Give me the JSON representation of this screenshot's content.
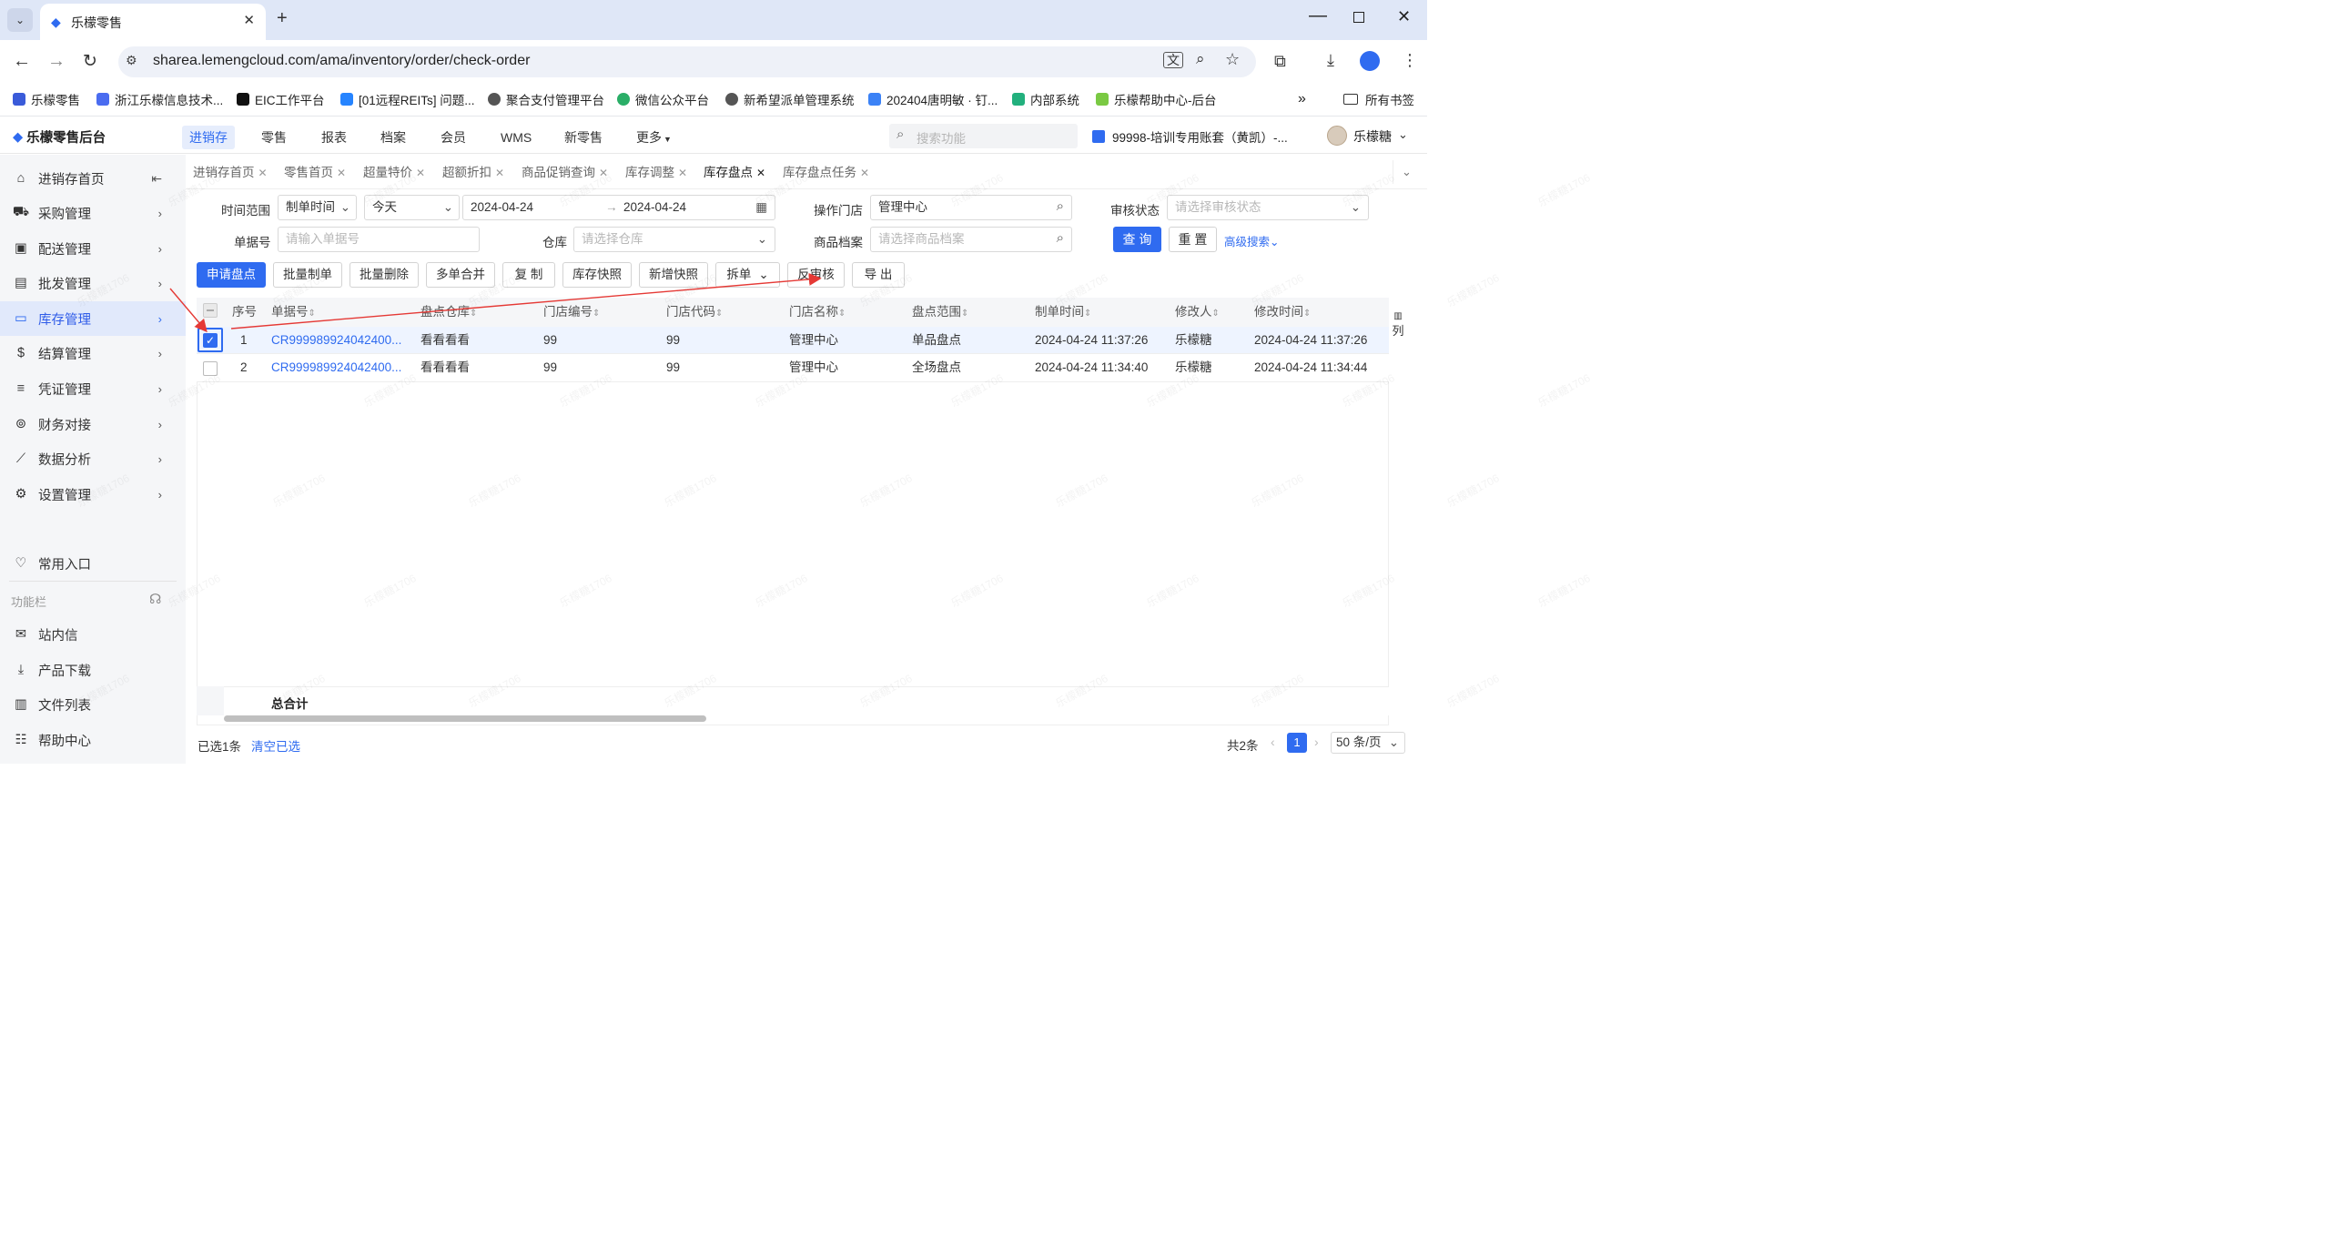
{
  "browser": {
    "tab_title": "乐檬零售",
    "url": "sharea.lemengcloud.com/ama/inventory/order/check-order",
    "bookmarks": [
      "乐檬零售",
      "浙江乐檬信息技术...",
      "EIC工作平台",
      "[01远程REITs] 问题...",
      "聚合支付管理平台",
      "微信公众平台",
      "新希望派单管理系统",
      "202404唐明敏 · 钉...",
      "内部系统",
      "乐檬帮助中心-后台"
    ],
    "all_bookmarks": "所有书签"
  },
  "app": {
    "logo": "乐檬零售后台",
    "nav": [
      "进销存",
      "零售",
      "报表",
      "档案",
      "会员",
      "WMS",
      "新零售",
      "更多"
    ],
    "search_placeholder": "搜索功能",
    "account": "99998-培训专用账套（黄凯）-...",
    "user": "乐檬糖"
  },
  "sidebar": {
    "items": [
      "进销存首页",
      "采购管理",
      "配送管理",
      "批发管理",
      "库存管理",
      "结算管理",
      "凭证管理",
      "财务对接",
      "数据分析",
      "设置管理"
    ],
    "common": "常用入口",
    "toolbar_label": "功能栏",
    "bottom": [
      "站内信",
      "产品下载",
      "文件列表",
      "帮助中心"
    ]
  },
  "page_tabs": [
    "进销存首页",
    "零售首页",
    "超量特价",
    "超额折扣",
    "商品促销查询",
    "库存调整",
    "库存盘点",
    "库存盘点任务"
  ],
  "form": {
    "time_range_label": "时间范围",
    "time_type": "制单时间",
    "time_preset": "今天",
    "date_from": "2024-04-24",
    "date_to": "2024-04-24",
    "store_label": "操作门店",
    "store_value": "管理中心",
    "audit_label": "审核状态",
    "audit_placeholder": "请选择审核状态",
    "order_no_label": "单据号",
    "order_no_placeholder": "请输入单据号",
    "warehouse_label": "仓库",
    "warehouse_placeholder": "请选择仓库",
    "product_label": "商品档案",
    "product_placeholder": "请选择商品档案",
    "query": "查 询",
    "reset": "重 置",
    "advanced": "高级搜索"
  },
  "actions": [
    "申请盘点",
    "批量制单",
    "批量删除",
    "多单合并",
    "复 制",
    "库存快照",
    "新增快照",
    "拆单",
    "反审核",
    "导 出"
  ],
  "table": {
    "headers": [
      "序号",
      "单据号",
      "盘点仓库",
      "门店编号",
      "门店代码",
      "门店名称",
      "盘点范围",
      "制单时间",
      "修改人",
      "修改时间"
    ],
    "rows": [
      {
        "no": "1",
        "order": "CR999989924042400...",
        "wh": "看看看看",
        "store_no": "99",
        "store_code": "99",
        "store_name": "管理中心",
        "scope": "单品盘点",
        "created": "2024-04-24 11:37:26",
        "editor": "乐檬糖",
        "modified": "2024-04-24 11:37:26",
        "checked": true
      },
      {
        "no": "2",
        "order": "CR999989924042400...",
        "wh": "看看看看",
        "store_no": "99",
        "store_code": "99",
        "store_name": "管理中心",
        "scope": "全场盘点",
        "created": "2024-04-24 11:34:40",
        "editor": "乐檬糖",
        "modified": "2024-04-24 11:34:44",
        "checked": false
      }
    ],
    "total_label": "总合计",
    "col_setting": "列"
  },
  "footer": {
    "selected": "已选1条",
    "clear": "清空已选",
    "total": "共2条",
    "page": "1",
    "page_size": "50 条/页"
  },
  "watermark": "乐檬糖1706",
  "colors": {
    "accent": "#2f6bf0",
    "link": "#2f6bf0",
    "arrow": "#e53935"
  }
}
